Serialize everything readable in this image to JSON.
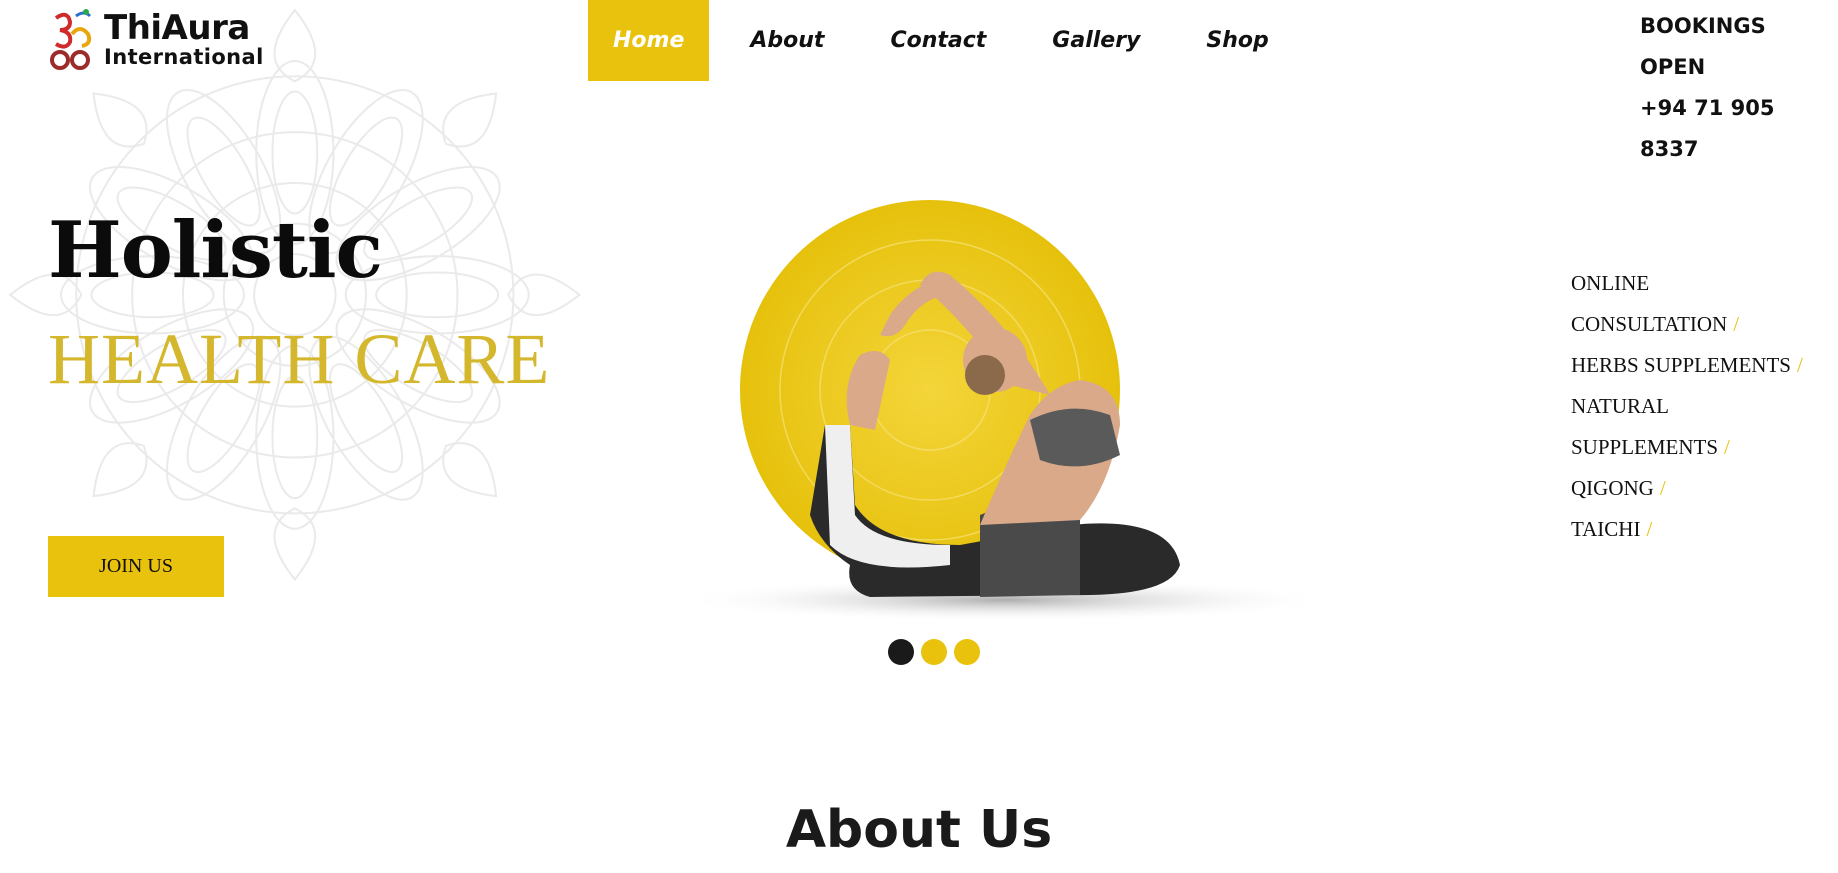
{
  "brand": {
    "name": "ThiAura",
    "subtitle": "International"
  },
  "nav": {
    "items": [
      {
        "label": "Home",
        "active": true
      },
      {
        "label": "About",
        "active": false
      },
      {
        "label": "Contact",
        "active": false
      },
      {
        "label": "Gallery",
        "active": false
      },
      {
        "label": "Shop",
        "active": false
      }
    ]
  },
  "contact": {
    "status": "BOOKINGS OPEN",
    "phone": "+94 71 905 8337"
  },
  "hero": {
    "title": "Holistic",
    "subtitle": "HEALTH CARE",
    "cta_label": "JOIN US",
    "slides": {
      "count": 3,
      "active_index": 0
    }
  },
  "services": {
    "lines": [
      {
        "text": "ONLINE",
        "slash": ""
      },
      {
        "text": "CONSULTATION",
        "slash": "/"
      },
      {
        "text": "HERBS SUPPLEMENTS",
        "slash": "/"
      },
      {
        "text": "NATURAL",
        "slash": ""
      },
      {
        "text": "SUPPLEMENTS",
        "slash": "/"
      },
      {
        "text": "QIGONG",
        "slash": "/"
      },
      {
        "text": "TAICHI",
        "slash": "/"
      }
    ]
  },
  "about": {
    "heading": "About Us"
  },
  "colors": {
    "accent": "#e8c20c",
    "accent_text": "#d4b72c",
    "text": "#111111",
    "dot_active": "#1a1a1a"
  },
  "icons": {
    "logo": "om-symbol-logo-icon"
  }
}
